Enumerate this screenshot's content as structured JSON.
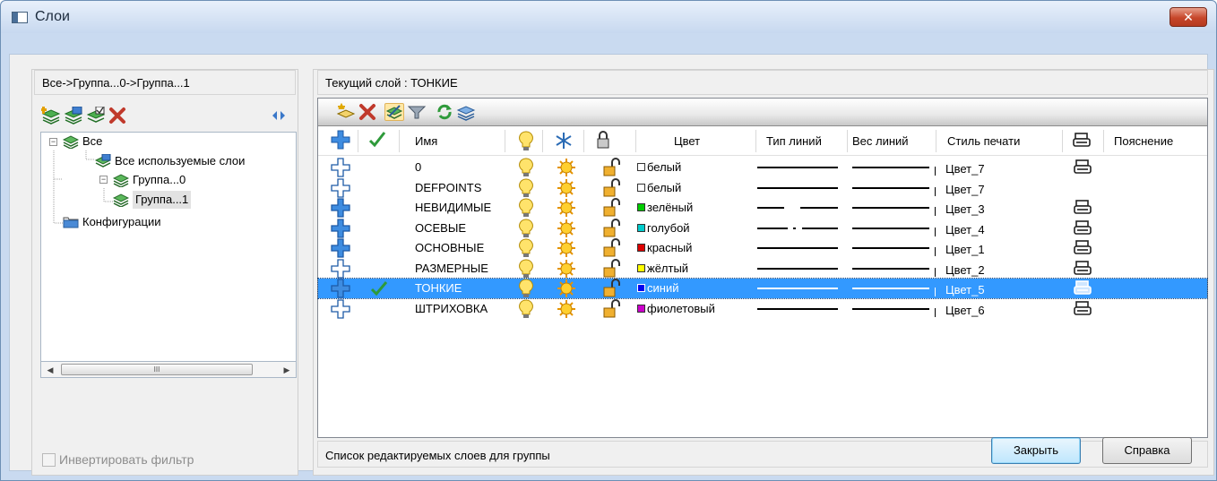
{
  "window": {
    "title": "Слои",
    "close_glyph": "✕"
  },
  "left": {
    "path": "Все->Группа...0->Группа...1",
    "tree": [
      {
        "label": "Все"
      },
      {
        "label": "Все используемые слои"
      },
      {
        "label": "Группа...0"
      },
      {
        "label": "Группа...1"
      },
      {
        "label": "Конфигурации"
      }
    ],
    "scroll_grip": "III",
    "invert_label": "Инвертировать фильтр"
  },
  "right": {
    "current_layer": "Текущий слой : ТОНКИЕ",
    "columns": {
      "name": "Имя",
      "color": "Цвет",
      "linetype": "Тип линий",
      "lineweight": "Вес линий",
      "plotstyle": "Стиль печати",
      "note": "Пояснение"
    },
    "rows": [
      {
        "name": "0",
        "color_name": "белый",
        "color": "#ffffff",
        "linetype": "solid",
        "plotstyle": "Цвет_7",
        "plot": true,
        "current": false,
        "selected": false,
        "used": false
      },
      {
        "name": "DEFPOINTS",
        "color_name": "белый",
        "color": "#ffffff",
        "linetype": "solid",
        "plotstyle": "Цвет_7",
        "plot": false,
        "current": false,
        "selected": false,
        "used": false
      },
      {
        "name": "НЕВИДИМЫЕ",
        "color_name": "зелёный",
        "color": "#00cc00",
        "linetype": "dashed",
        "plotstyle": "Цвет_3",
        "plot": true,
        "current": false,
        "selected": false,
        "used": true
      },
      {
        "name": "ОСЕВЫЕ",
        "color_name": "голубой",
        "color": "#00cccc",
        "linetype": "center",
        "plotstyle": "Цвет_4",
        "plot": true,
        "current": false,
        "selected": false,
        "used": true
      },
      {
        "name": "ОСНОВНЫЕ",
        "color_name": "красный",
        "color": "#dd0000",
        "linetype": "solid",
        "plotstyle": "Цвет_1",
        "plot": true,
        "current": false,
        "selected": false,
        "used": true
      },
      {
        "name": "РАЗМЕРНЫЕ",
        "color_name": "жёлтый",
        "color": "#ffff00",
        "linetype": "solid",
        "plotstyle": "Цвет_2",
        "plot": true,
        "current": false,
        "selected": false,
        "used": false
      },
      {
        "name": "ТОНКИЕ",
        "color_name": "синий",
        "color": "#0000ee",
        "linetype": "solid",
        "plotstyle": "Цвет_5",
        "plot": true,
        "current": true,
        "selected": true,
        "used": false
      },
      {
        "name": "ШТРИХОВКА",
        "color_name": "фиолетовый",
        "color": "#cc00cc",
        "linetype": "solid",
        "plotstyle": "Цвет_6",
        "plot": true,
        "current": false,
        "selected": false,
        "used": false
      }
    ],
    "status": "Список редактируемых слоев для группы"
  },
  "buttons": {
    "close": "Закрыть",
    "help": "Справка"
  }
}
